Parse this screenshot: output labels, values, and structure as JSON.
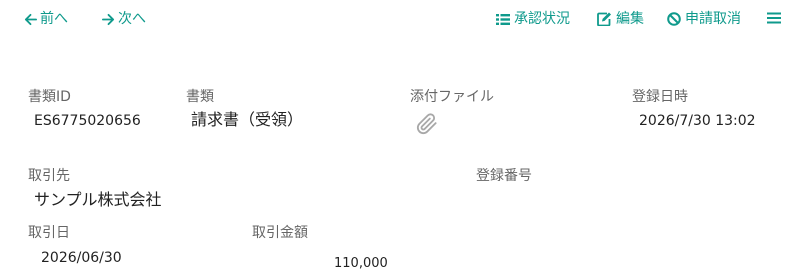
{
  "toolbar": {
    "prev_label": "前へ",
    "next_label": "次へ",
    "approval_status_label": "承認状況",
    "edit_label": "編集",
    "cancel_request_label": "申請取消"
  },
  "fields": {
    "document_id": {
      "label": "書類ID",
      "value": "ES6775020656"
    },
    "document_type": {
      "label": "書類",
      "value": "請求書（受領）"
    },
    "attachment": {
      "label": "添付ファイル"
    },
    "registered_at": {
      "label": "登録日時",
      "value": "2026/7/30 13:02"
    },
    "partner": {
      "label": "取引先",
      "value": "サンプル株式会社"
    },
    "registration_number": {
      "label": "登録番号",
      "value": ""
    },
    "transaction_date": {
      "label": "取引日",
      "value": "2026/06/30"
    },
    "transaction_amount": {
      "label": "取引金額",
      "value": "110,000"
    }
  },
  "colors": {
    "accent": "#0f9a8c",
    "label": "#666666",
    "text": "#222222"
  },
  "icons": [
    "arrow-left-icon",
    "arrow-right-icon",
    "list-icon",
    "edit-icon",
    "ban-icon",
    "menu-icon",
    "paperclip-icon"
  ]
}
